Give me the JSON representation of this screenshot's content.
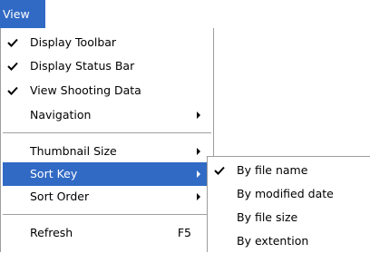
{
  "colors": {
    "menubar_bg": "#316ac5",
    "highlight_bg": "#316ac5",
    "menu_bg": "#ffffff",
    "menu_border": "#9d9d9d",
    "separator": "#a0a0a0"
  },
  "menubar": {
    "view_label": "View"
  },
  "view_menu": {
    "items": [
      {
        "label": "Display Toolbar",
        "checked": true,
        "icon": "checkmark-icon"
      },
      {
        "label": "Display Status Bar",
        "checked": true,
        "icon": "checkmark-icon"
      },
      {
        "label": "View Shooting Data",
        "checked": true,
        "icon": "checkmark-icon"
      },
      {
        "label": "Navigation",
        "submenu": true,
        "icon": "submenu-arrow-icon"
      },
      {
        "label": "Thumbnail Size",
        "submenu": true,
        "icon": "submenu-arrow-icon"
      },
      {
        "label": "Sort Key",
        "submenu": true,
        "highlighted": true,
        "icon": "submenu-arrow-icon"
      },
      {
        "label": "Sort Order",
        "submenu": true,
        "icon": "submenu-arrow-icon"
      },
      {
        "label": "Refresh",
        "shortcut": "F5"
      }
    ]
  },
  "sort_key_menu": {
    "items": [
      {
        "label": "By file name",
        "checked": true,
        "icon": "checkmark-icon"
      },
      {
        "label": "By modified date",
        "checked": false
      },
      {
        "label": "By file size",
        "checked": false
      },
      {
        "label": "By extention",
        "checked": false
      }
    ]
  }
}
